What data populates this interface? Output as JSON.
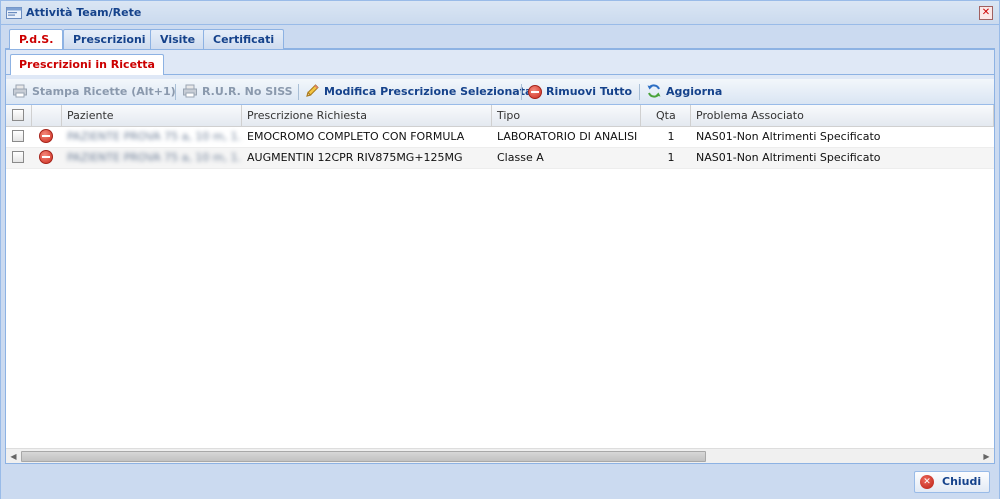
{
  "window": {
    "title": "Attività Team/Rete",
    "close_glyph": "✕"
  },
  "tabs": [
    {
      "label": "P.d.S.",
      "active": true
    },
    {
      "label": "Prescrizioni",
      "active": false
    },
    {
      "label": "Visite",
      "active": false
    },
    {
      "label": "Certificati",
      "active": false
    }
  ],
  "subtab": {
    "label": "Prescrizioni in Ricetta"
  },
  "toolbar": {
    "stampa": "Stampa Ricette (Alt+1)",
    "rur": "R.U.R. No SISS",
    "modifica": "Modifica Prescrizione Selezionata",
    "rimuovi": "Rimuovi Tutto",
    "aggiorna": "Aggiorna"
  },
  "grid": {
    "columns": {
      "paziente": "Paziente",
      "prescrizione": "Prescrizione Richiesta",
      "tipo": "Tipo",
      "qta": "Qta",
      "problema": "Problema Associato"
    },
    "rows": [
      {
        "paziente": "PAZIENTE PROVA 75 a, 10 m, 1...",
        "prescrizione": "EMOCROMO COMPLETO CON FORMULA",
        "tipo": "LABORATORIO DI ANALISI",
        "qta": "1",
        "problema": "NAS01-Non Altrimenti Specificato"
      },
      {
        "paziente": "PAZIENTE PROVA 75 a, 10 m, 1...",
        "prescrizione": "AUGMENTIN 12CPR RIV875MG+125MG",
        "tipo": "Classe A",
        "qta": "1",
        "problema": "NAS01-Non Altrimenti Specificato"
      }
    ]
  },
  "footer": {
    "close_label": "Chiudi"
  },
  "icons": {
    "title": "window-app-icon",
    "stampa": "printer-icon",
    "rur": "printer-icon",
    "modifica": "pencil-icon",
    "rimuovi": "remove-icon",
    "aggiorna": "refresh-icon",
    "row_remove": "remove-icon",
    "close": "close-icon"
  },
  "colors": {
    "accent": "#15428b",
    "active_tab": "#cc0000",
    "panel": "#dfe8f6",
    "border": "#99bbe8"
  }
}
